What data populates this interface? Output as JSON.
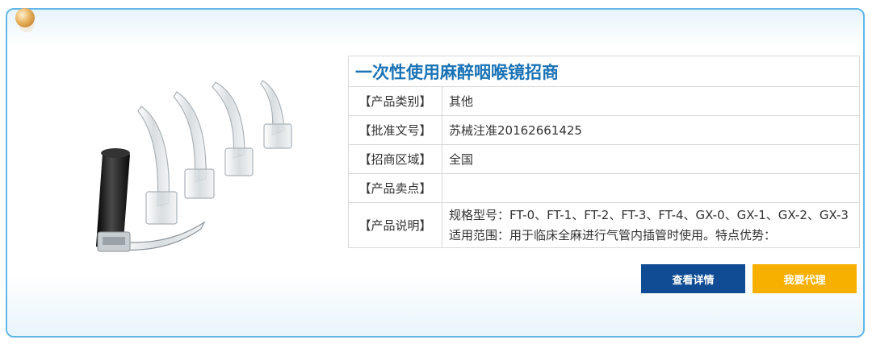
{
  "product": {
    "title": "一次性使用麻醉咽喉镜招商",
    "rows": [
      {
        "label": "【产品类别】",
        "value": "其他"
      },
      {
        "label": "【批准文号】",
        "value": "苏械注准20162661425"
      },
      {
        "label": "【招商区域】",
        "value": "全国"
      },
      {
        "label": "【产品卖点】",
        "value": ""
      }
    ],
    "description": {
      "label": "【产品说明】",
      "value": "规格型号：FT-0、FT-1、FT-2、FT-3、FT-4、GX-0、GX-1、GX-2、GX-3适用范围：用于临床全麻进行气管内插管时使用。特点优势："
    }
  },
  "buttons": {
    "detail": "查看详情",
    "agent": "我要代理"
  },
  "colors": {
    "border": "#62b7e8",
    "title": "#1a73b6",
    "detail_button": "#0f4c94",
    "agent_button": "#f8b000"
  },
  "icons": [
    "corner-ball-icon"
  ]
}
